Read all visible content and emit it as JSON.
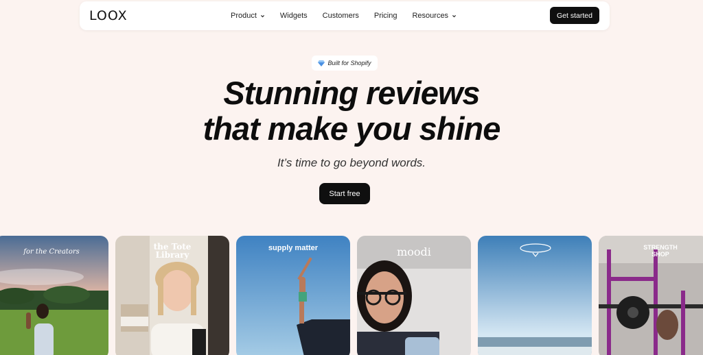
{
  "brand": {
    "logo": "LOOX"
  },
  "nav": {
    "links": [
      {
        "label": "Product",
        "dropdown": true
      },
      {
        "label": "Widgets",
        "dropdown": false
      },
      {
        "label": "Customers",
        "dropdown": false
      },
      {
        "label": "Pricing",
        "dropdown": false
      },
      {
        "label": "Resources",
        "dropdown": true
      }
    ],
    "cta": "Get started"
  },
  "hero": {
    "badge": "Built for Shopify",
    "headline_line1": "Stunning reviews",
    "headline_line2": "that make you shine",
    "subhead": "It’s time to go beyond words.",
    "cta": "Start free"
  },
  "cards": [
    {
      "brand": "for the Creators"
    },
    {
      "brand": "the Tote Library"
    },
    {
      "brand": "supply matter"
    },
    {
      "brand": "moodi"
    },
    {
      "brand": ""
    },
    {
      "brand": "STRENGTH SHOP"
    }
  ],
  "colors": {
    "background": "#fcf3f0",
    "primary": "#0f0f0f",
    "surface": "#ffffff"
  }
}
